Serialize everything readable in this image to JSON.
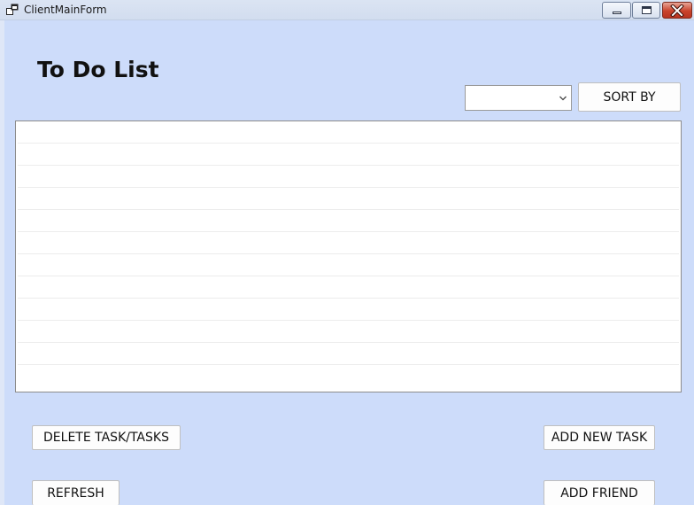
{
  "window": {
    "title": "ClientMainForm",
    "icons": {
      "app": "window-app-icon",
      "minimize": "minimize-icon",
      "maximize": "maximize-icon",
      "close": "close-icon"
    }
  },
  "main": {
    "heading": "To Do List",
    "sort": {
      "selected": "",
      "button_label": "SORT BY"
    },
    "task_list": {
      "rows": [
        "",
        "",
        "",
        "",
        "",
        "",
        "",
        "",
        "",
        "",
        ""
      ]
    },
    "buttons": {
      "delete": "DELETE TASK/TASKS",
      "add_task": "ADD NEW TASK",
      "refresh": "REFRESH",
      "add_friend": "ADD FRIEND"
    }
  },
  "colors": {
    "background": "#cddcfa",
    "close_button": "#c9432c"
  }
}
